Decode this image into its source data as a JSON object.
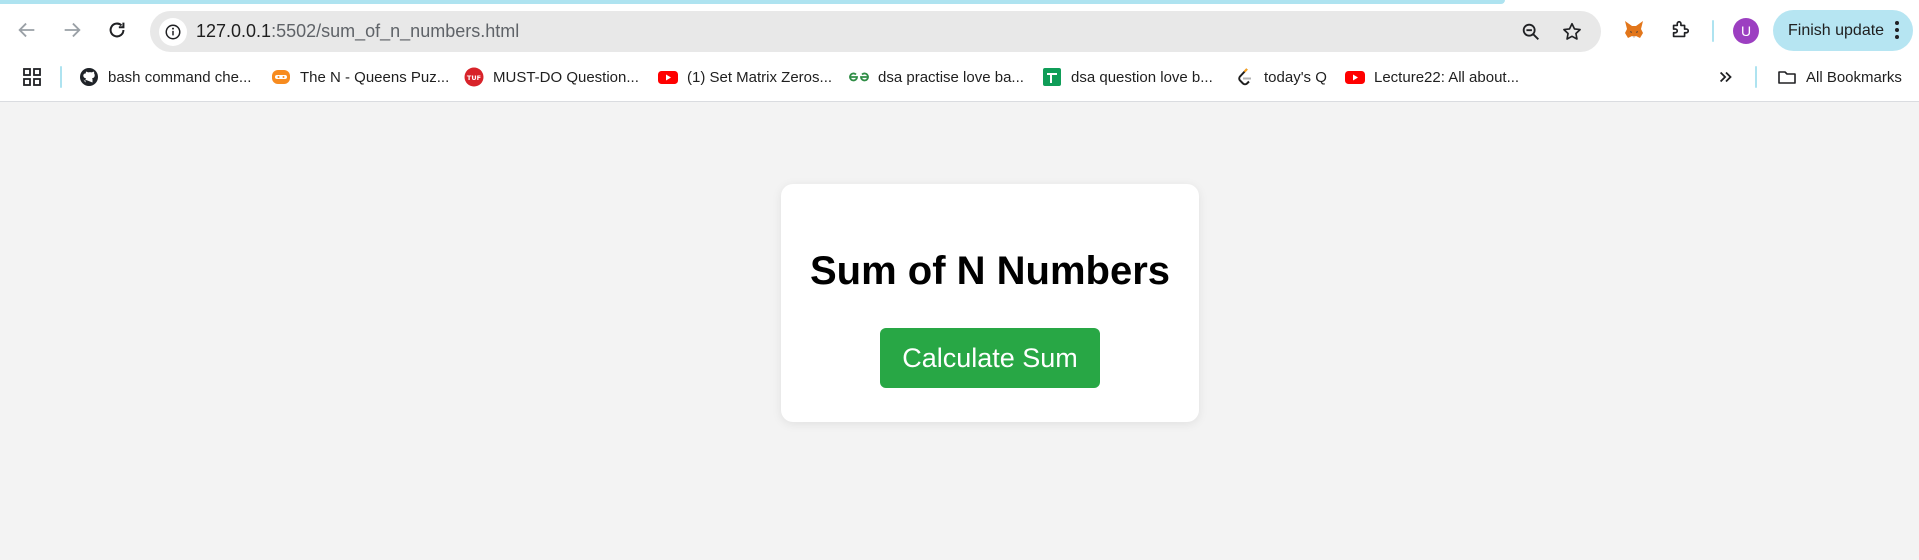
{
  "browser": {
    "url_host": "127.0.0.1",
    "url_path": ":5502/sum_of_n_numbers.html",
    "profile_initial": "U",
    "finish_update_label": "Finish update",
    "colors": {
      "accent": "#aee3f0",
      "finish_update_bg": "#b6e5f2",
      "avatar": "#9c3fc1"
    }
  },
  "bookmarks": {
    "items": [
      {
        "label": "bash command che...",
        "icon": "github-icon"
      },
      {
        "label": "The N - Queens Puz...",
        "icon": "codingninjas-icon"
      },
      {
        "label": "MUST-DO Question...",
        "icon": "tuf-icon"
      },
      {
        "label": "(1) Set Matrix Zeros...",
        "icon": "youtube-icon"
      },
      {
        "label": "dsa practise love ba...",
        "icon": "geeksforgeeks-icon"
      },
      {
        "label": "dsa question love b...",
        "icon": "google-sheets-icon"
      },
      {
        "label": "today's Q",
        "icon": "leetcode-icon"
      },
      {
        "label": "Lecture22: All about...",
        "icon": "youtube-icon"
      }
    ],
    "all_bookmarks_label": "All Bookmarks"
  },
  "page": {
    "title": "Sum of N Numbers",
    "button_label": "Calculate Sum",
    "colors": {
      "background": "#f3f3f3",
      "button": "#28a745"
    }
  }
}
